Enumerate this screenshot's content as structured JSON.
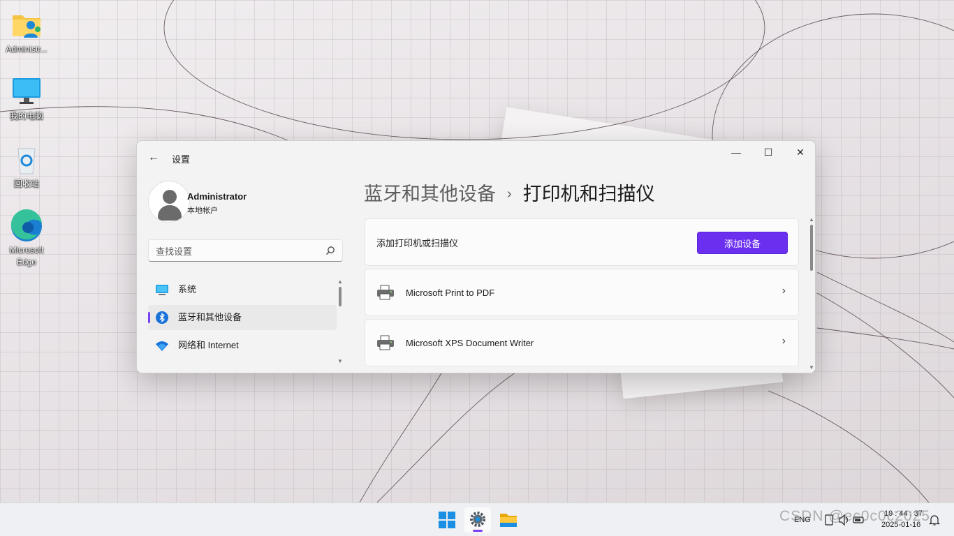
{
  "desktop": {
    "icons": [
      {
        "label": "Administr..."
      },
      {
        "label": "我的电脑"
      },
      {
        "label": "回收站"
      },
      {
        "label": "Microsoft Edge"
      }
    ]
  },
  "window": {
    "app_title": "设置",
    "controls": {
      "minimize": "—",
      "maximize": "☐",
      "close": "✕"
    }
  },
  "profile": {
    "name": "Administrator",
    "account_type": "本地帐户"
  },
  "search": {
    "placeholder": "查找设置"
  },
  "nav": {
    "items": [
      {
        "label": "系统",
        "icon": "monitor-icon"
      },
      {
        "label": "蓝牙和其他设备",
        "icon": "bluetooth-icon",
        "active": true
      },
      {
        "label": "网络和 Internet",
        "icon": "wifi-icon"
      }
    ]
  },
  "breadcrumb": {
    "parent": "蓝牙和其他设备",
    "separator": "›",
    "current": "打印机和扫描仪"
  },
  "add_card": {
    "label": "添加打印机或扫描仪",
    "button": "添加设备"
  },
  "printers": [
    {
      "name": "Microsoft Print to PDF",
      "icon": "printer-icon"
    },
    {
      "name": "Microsoft XPS Document Writer",
      "icon": "printer-icon"
    }
  ],
  "taskbar": {
    "language": "ENG",
    "time": "19 : 44 : 37",
    "date": "2025-01-16",
    "watermark": "CSDN @ec0c0c2025"
  },
  "colors": {
    "accent": "#6b2ff0",
    "active_indicator": "#7a3ff2",
    "window_bg": "#f3f3f3",
    "card_bg": "#fbfbfb"
  }
}
